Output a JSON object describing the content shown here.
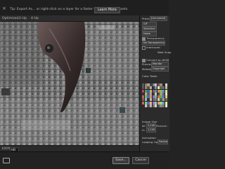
{
  "tip": {
    "text": "Tip: Export As... or right-click on a layer for a faster way to export assets.",
    "learn_more": "Learn More"
  },
  "tabs": [
    "Optimized",
    "2-Up",
    "4-Up"
  ],
  "status": {
    "zoom_label": "100%",
    "field_value": "HB"
  },
  "panel": {
    "preset_label": "Preset:",
    "preset_value": "[Unnamed]",
    "format_value": "GIF",
    "reduction_value": "Selective",
    "dither_algo": "Noise",
    "transparency": "Transparency",
    "matte_value": "No Transparency Dither",
    "interlaced": "Interlaced",
    "web_snap": "Web Snap",
    "convert_srgb": "Convert to sRGB",
    "preview_label": "Preview:",
    "preview_value": "Monitor Color",
    "metadata_label": "Metadata:",
    "metadata_value": "Copyright and Contact Info",
    "color_table_label": "Color Table",
    "image_size_label": "Image Size",
    "w_label": "W:",
    "w_value": "1,140",
    "h_label": "H:",
    "h_value": "1,140",
    "percent_label": "Percent:",
    "animation_label": "Animation",
    "looping_label": "Looping Options:",
    "looping_value": "Forever"
  },
  "footer": {
    "preview_icon": "browser-preview-icon",
    "save_label": "Save...",
    "cancel_label": "Cancel"
  },
  "colors": {
    "table": [
      "#5a5a5a",
      "#8d7a6a",
      "#b0a090",
      "#3a4a5a",
      "#7a8a9a",
      "#c9c0b0",
      "#6a5a4a",
      "#9a8a7a",
      "#2a2a2a",
      "#d8d0c8",
      "#4a5a6a",
      "#a08070",
      "#605040",
      "#bcb0a0",
      "#303840",
      "#8090a0",
      "#e0d8d0",
      "#706050",
      "#5a6a7a",
      "#c0b8a8",
      "#d04040",
      "#40a040",
      "#4060c0",
      "#c0c040",
      "#a040a0",
      "#40a0a0",
      "#e08040",
      "#80c040",
      "#6080e0",
      "#e0e080",
      "#2a3a4a",
      "#b8a898",
      "#785848",
      "#9aa8b8",
      "#483828",
      "#d0c0b0",
      "#384858",
      "#a89888",
      "#606870",
      "#e8e0d8",
      "#c06060",
      "#60c060",
      "#6060c0",
      "#c0a060",
      "#a060c0",
      "#60c0a0",
      "#d07050",
      "#70a050",
      "#5070d0",
      "#d0d070",
      "#806050",
      "#a0b0c0",
      "#403020",
      "#c8b8a8",
      "#586878",
      "#907868",
      "#d8c8b8",
      "#506070",
      "#b09888",
      "#7a6a5a",
      "#e06060",
      "#60e060",
      "#6060e0",
      "#e0c060",
      "#c060e0",
      "#60e0c0",
      "#f09060",
      "#90e060",
      "#6090f0",
      "#f0f090",
      "#3a2a1a",
      "#c0c8d0",
      "#6a4a3a",
      "#a8b8c8",
      "#8a6a5a",
      "#dcd4cc",
      "#485868",
      "#988878",
      "#707880",
      "#f0e8e0"
    ]
  }
}
